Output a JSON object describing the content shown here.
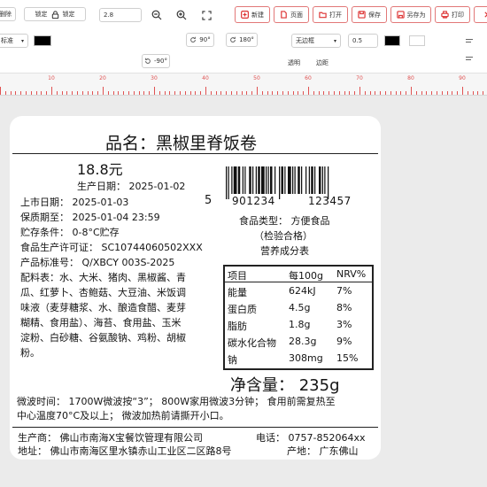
{
  "toolbar": {
    "delete_label": "删除",
    "lock_label": "锁定",
    "lock2_label": "锁定",
    "zoom_value": "2.8",
    "new_label": "新建",
    "page_label": "页面",
    "open_label": "打开",
    "save_label": "保存",
    "saveas_label": "另存为",
    "print_label": "打印",
    "line_style_label": "标准",
    "rotate_90_label": "90°",
    "rotate_180_label": "180°",
    "rotate_neg90_label": "-90°",
    "border_select_value": "无边框",
    "border_width_value": "0.5",
    "transparent_label": "透明",
    "margin_label": "边距",
    "colors": {
      "black": "#000000",
      "white": "#ffffff",
      "accent": "#d33333"
    }
  },
  "ruler": {
    "labels": [
      "10",
      "20",
      "30",
      "40",
      "50",
      "60",
      "70",
      "80",
      "90"
    ]
  },
  "label": {
    "product_name": "品名：黑椒里脊饭卷",
    "price": "18.8元",
    "production_date": "生产日期：  2025-01-02",
    "market_date": "上市日期：  2025-01-03",
    "shelf_until": "保质期至：  2025-01-04 23:59",
    "storage": "贮存条件：  0-8°C贮存",
    "license": "食品生产许可证：  SC10744060502XXX",
    "standard": "产品标准号：  Q/XBCY 003S-2025",
    "ingredients_lines": [
      "配料表：水、大米、猪肉、黑椒酱、青",
      "瓜、红萝卜、杏鲍菇、大豆油、米饭调",
      "味液（麦芽糖浆、水、酿造食醋、麦芽",
      "糊精、食用盐）、海苔、食用盐、玉米",
      "淀粉、白砂糖、谷氨酸钠、鸡粉、胡椒",
      "粉。"
    ],
    "barcode": {
      "lead": "5",
      "left_group": "901234",
      "right_group": "123457"
    },
    "food_type": "食品类型：  方便食品",
    "inspection": "（检验合格）",
    "nutrition_title": "营养成分表",
    "nutrition": {
      "headers": [
        "项目",
        "每100g",
        "NRV%"
      ],
      "rows": [
        [
          "能量",
          "624kJ",
          "7%"
        ],
        [
          "蛋白质",
          "4.5g",
          "8%"
        ],
        [
          "脂肪",
          "1.8g",
          "3%"
        ],
        [
          "碳水化合物",
          "28.3g",
          "9%"
        ],
        [
          "钠",
          "308mg",
          "15%"
        ]
      ]
    },
    "net_weight": "净含量：  235g",
    "microwave_lines": [
      "微波时间：  1700W微波按“3”；  800W家用微波3分钟；  食用前需复热至",
      "中心温度70°C及以上；  微波加热前请撕开小口。"
    ],
    "producer": "生产商：  佛山市南海X宝餐饮管理有限公司",
    "phone": "电话：  0757-852064xx",
    "address": "地址：  佛山市南海区里水镇赤山工业区二区路8号",
    "origin": "产地：  广东佛山"
  }
}
